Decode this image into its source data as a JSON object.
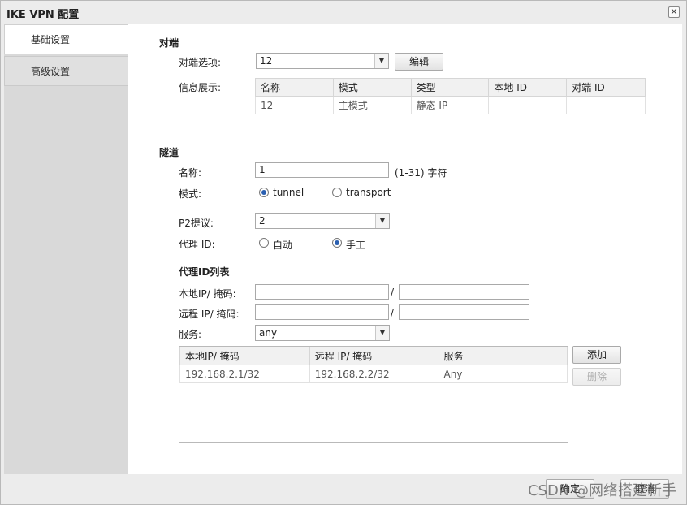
{
  "window": {
    "title": "IKE VPN 配置",
    "close_label": "✕"
  },
  "sidebar": {
    "items": [
      {
        "label": "基础设置",
        "active": true
      },
      {
        "label": "高级设置",
        "active": false
      }
    ]
  },
  "peer": {
    "section_title": "对端",
    "option_label": "对端选项:",
    "option_value": "12",
    "edit_button": "编辑",
    "info_label": "信息展示:",
    "table": {
      "headers": [
        "名称",
        "模式",
        "类型",
        "本地 ID",
        "对端 ID"
      ],
      "rows": [
        [
          "12",
          "主模式",
          "静态 IP",
          "",
          ""
        ]
      ]
    }
  },
  "tunnel": {
    "section_title": "隧道",
    "name_label": "名称:",
    "name_value": "1",
    "name_hint": "(1-31) 字符",
    "mode_label": "模式:",
    "mode_options": [
      "tunnel",
      "transport"
    ],
    "mode_selected": "tunnel",
    "p2_label": "P2提议:",
    "p2_value": "2",
    "proxy_label": "代理 ID:",
    "proxy_options": [
      "自动",
      "手工"
    ],
    "proxy_selected": "手工"
  },
  "proxy_list": {
    "section_title": "代理ID列表",
    "local_label": "本地IP/ 掩码:",
    "remote_label": "远程 IP/ 掩码:",
    "separator": "/",
    "service_label": "服务:",
    "service_value": "any",
    "table": {
      "headers": [
        "本地IP/ 掩码",
        "远程 IP/ 掩码",
        "服务"
      ],
      "rows": [
        [
          "192.168.2.1/32",
          "192.168.2.2/32",
          "Any"
        ]
      ]
    },
    "add_button": "添加",
    "delete_button": "删除"
  },
  "footer": {
    "ok_button": "确定",
    "cancel_button": "取消"
  },
  "watermark": "CSDN @网络搭建新手"
}
